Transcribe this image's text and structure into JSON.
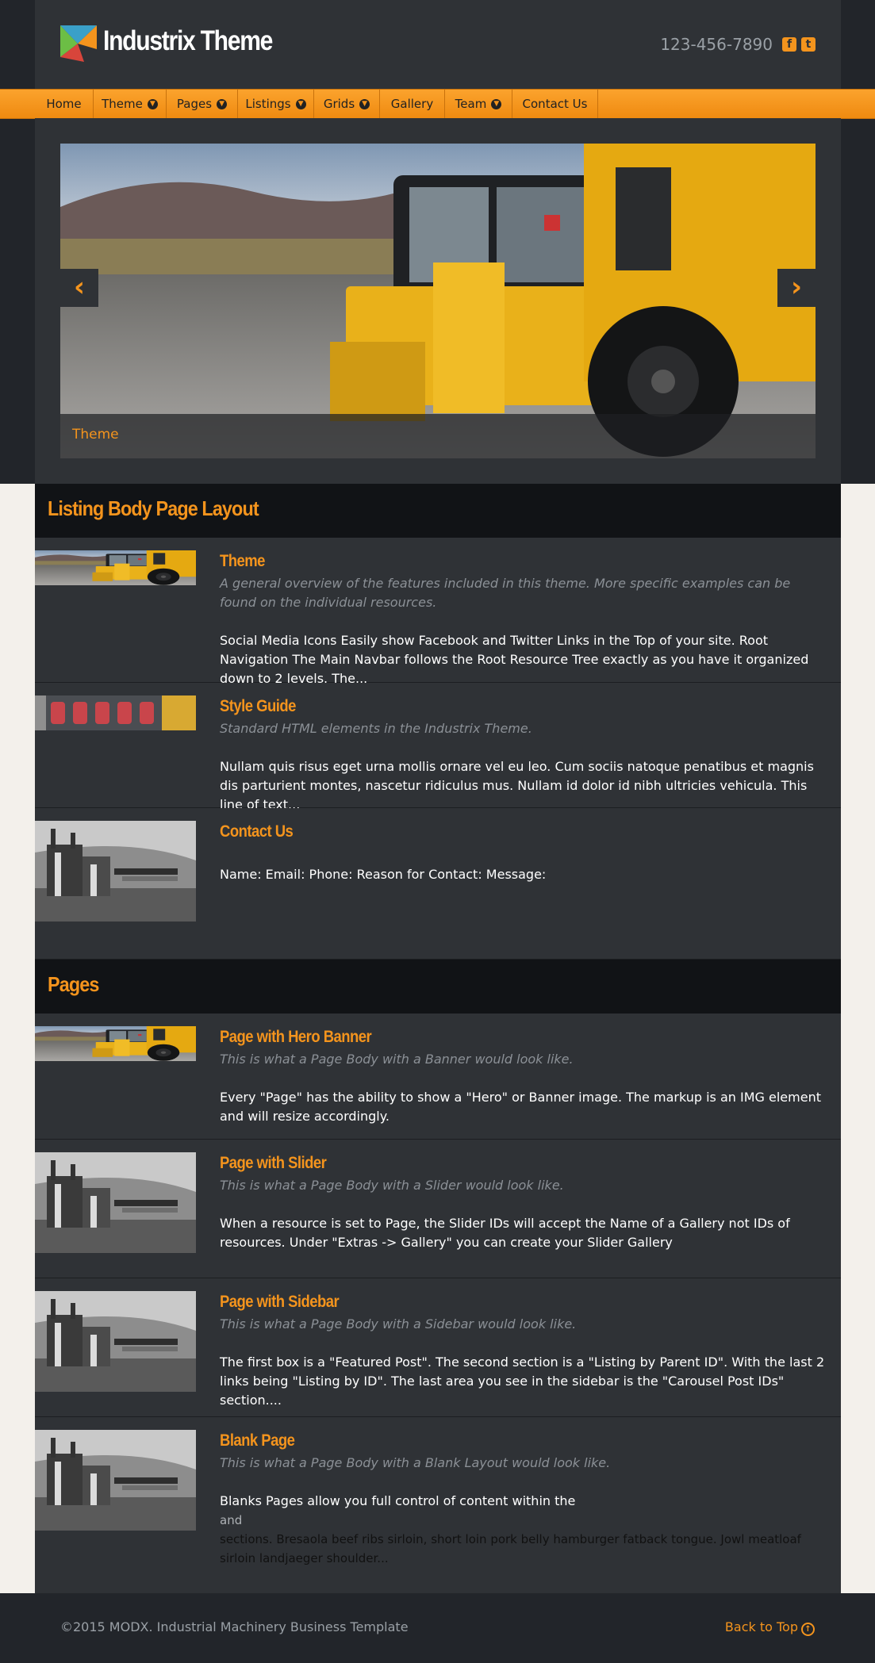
{
  "brand": {
    "name": "Industrix Theme",
    "phone": "123-456-7890",
    "facebook_icon": "facebook-square-icon",
    "twitter_icon": "twitter-square-icon"
  },
  "nav": {
    "items": [
      {
        "label": "Home",
        "has_dropdown": false
      },
      {
        "label": "Theme",
        "has_dropdown": true
      },
      {
        "label": "Pages",
        "has_dropdown": true
      },
      {
        "label": "Listings",
        "has_dropdown": true
      },
      {
        "label": "Grids",
        "has_dropdown": true
      },
      {
        "label": "Gallery",
        "has_dropdown": false
      },
      {
        "label": "Team",
        "has_dropdown": true
      },
      {
        "label": "Contact Us",
        "has_dropdown": false
      }
    ]
  },
  "slider": {
    "caption": "Theme",
    "prev_icon": "chevron-left-icon",
    "next_icon": "chevron-right-icon"
  },
  "sections": [
    {
      "heading": "Listing Body Page Layout",
      "items": [
        {
          "title": "Theme",
          "desc": "A general overview of the features included in this theme. More specific examples can be found on the individual resources.",
          "text": "Social Media Icons Easily show Facebook and Twitter Links in the Top of your site. Root Navigation The Main Navbar follows the Root Resource Tree exactly as you have it organized down to 2 levels. The..."
        },
        {
          "title": "Style Guide",
          "desc": "Standard HTML elements in the Industrix Theme.",
          "text": "Nullam quis risus eget urna mollis ornare vel eu leo. Cum sociis natoque penatibus et magnis dis parturient montes, nascetur ridiculus mus. Nullam id dolor id nibh ultricies vehicula. This line of text..."
        },
        {
          "title": "Contact Us",
          "desc": "",
          "text": "Name: Email: Phone: Reason for Contact: Message:"
        }
      ]
    },
    {
      "heading": "Pages",
      "items": [
        {
          "title": "Page with Hero Banner",
          "desc": "This is what a Page Body with a Banner would look like.",
          "text": "Every \"Page\" has the ability to show a \"Hero\" or Banner image. The markup is an IMG element and will resize accordingly."
        },
        {
          "title": "Page with Slider",
          "desc": "This is what a Page Body with a Slider would look like.",
          "text": "When a resource is set to Page, the Slider IDs will accept the Name of a Gallery not IDs of resources. Under \"Extras -> Gallery\" you can create your Slider Gallery"
        },
        {
          "title": "Page with Sidebar",
          "desc": "This is what a Page Body with a Sidebar would look like.",
          "text": "The first box is a \"Featured Post\". The second section is a \"Listing by Parent ID\". With the last 2 links being \"Listing by ID\". The last area you see in the sidebar is the \"Carousel Post IDs\" section...."
        },
        {
          "title": "Blank Page",
          "desc": "This is what a Page Body with a Blank Layout would look like.",
          "text_line1": "Blanks Pages allow you full control of content within the",
          "text_line2": "and",
          "text_line3": "sections. Bresaola beef ribs sirloin, short loin pork belly hamburger fatback tongue. Jowl meatloaf sirloin landjaeger shoulder..."
        }
      ]
    }
  ],
  "footer": {
    "copyright": "©2015 MODX. Industrial Machinery Business Template",
    "back_to_top": "Back to Top",
    "back_icon": "arrow-circle-up-icon"
  }
}
